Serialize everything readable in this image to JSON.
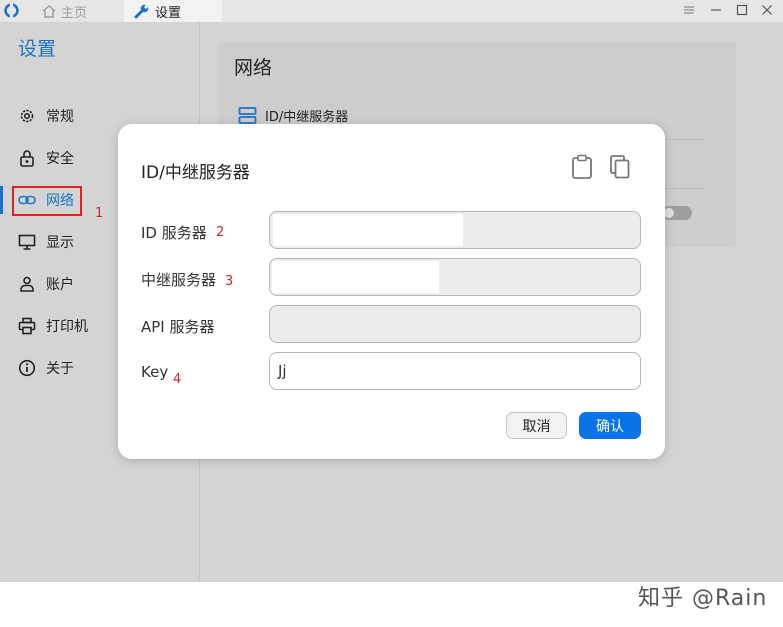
{
  "titlebar": {
    "tabs": [
      {
        "label": "主页",
        "icon": "home-icon"
      },
      {
        "label": "设置",
        "icon": "wrench-icon"
      }
    ],
    "controls": [
      "menu-icon",
      "minimize-icon",
      "maximize-icon",
      "close-icon"
    ]
  },
  "sidebar": {
    "title": "设置",
    "items": [
      {
        "label": "常规",
        "icon": "gear-icon"
      },
      {
        "label": "安全",
        "icon": "lock-icon"
      },
      {
        "label": "网络",
        "icon": "link-icon",
        "active": true
      },
      {
        "label": "显示",
        "icon": "monitor-icon"
      },
      {
        "label": "账户",
        "icon": "user-icon"
      },
      {
        "label": "打印机",
        "icon": "printer-icon"
      },
      {
        "label": "关于",
        "icon": "info-icon"
      }
    ]
  },
  "content": {
    "title": "网络",
    "row_label": "ID/中继服务器"
  },
  "dialog": {
    "title": "ID/中继服务器",
    "fields": [
      {
        "label": "ID 服务器",
        "value": ""
      },
      {
        "label": "中继服务器",
        "value": ""
      },
      {
        "label": "API 服务器",
        "value": ""
      },
      {
        "label": "Key",
        "value": "Jj"
      }
    ],
    "cancel": "取消",
    "confirm": "确认"
  },
  "annotations": [
    "1",
    "2",
    "3",
    "4"
  ],
  "watermark": "知乎 @Rain",
  "colors": {
    "accent": "#1a73c9",
    "primary_button": "#0a73e8",
    "annotation": "#d22222"
  }
}
